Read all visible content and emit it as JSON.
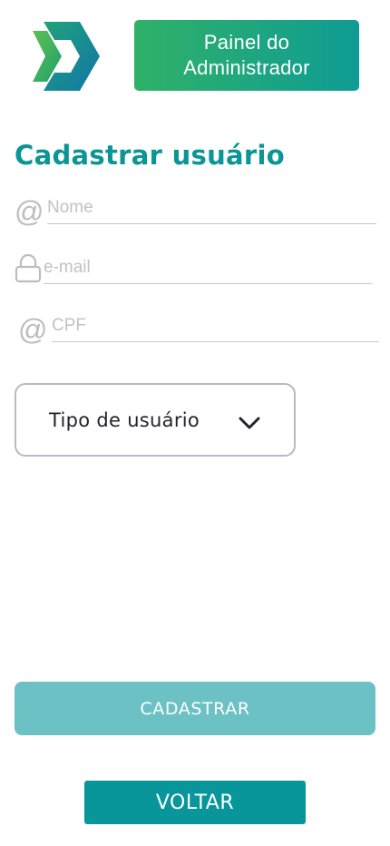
{
  "header": {
    "logo_icon": "d-arrow-logo",
    "admin_panel_label": "Painel do Administrador"
  },
  "page": {
    "title": "Cadastrar usuário"
  },
  "form": {
    "name": {
      "placeholder": "Nome",
      "icon": "at-icon"
    },
    "email": {
      "placeholder": "e-mail",
      "icon": "lock-icon"
    },
    "cpf": {
      "placeholder": "CPF",
      "icon": "at-icon"
    },
    "user_type": {
      "label": "Tipo de usuário",
      "icon": "chevron-down-icon"
    }
  },
  "actions": {
    "submit_label": "CADASTRAR",
    "back_label": "VOLTAR"
  },
  "colors": {
    "brand_teal": "#0b9595",
    "gradient_start": "#2fb168",
    "gradient_end": "#0f9c94",
    "submit_disabled": "#6cc1c4",
    "back_button": "#08969a"
  }
}
